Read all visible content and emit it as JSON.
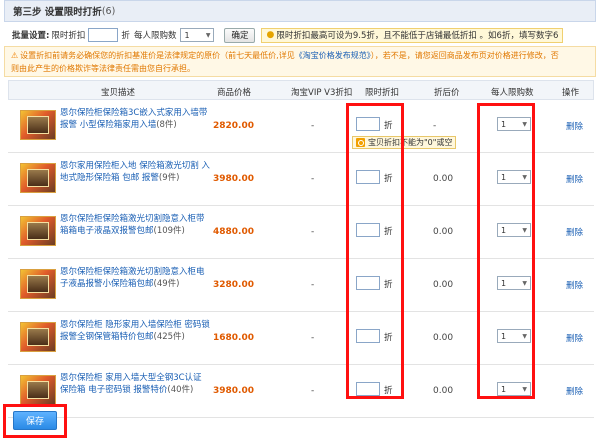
{
  "header": {
    "title": "第三步 设置限时打折",
    "count": "(6)"
  },
  "batch": {
    "label": "批量设置:",
    "discount_label": "限时折扣",
    "unit": "折",
    "limit_label": "每人限购数",
    "limit_value": "1",
    "confirm_label": "确定",
    "tip": "限时折扣最高可设为9.5折，且不能低于店铺最低折扣 。如6折，填写数字6"
  },
  "notice": {
    "line1_pre": "设置折扣前请务必确保您的折扣基准价是法律规定的原价（前七天最低价,详见",
    "link": "《淘宝价格发布规范》",
    "line1_post": "），若不是，请您返回商品发布页对价格进行修改，否",
    "line2": "则由此产生的价格欺诈等法律责任需由您自行承担。"
  },
  "table": {
    "columns": {
      "item": "宝贝描述",
      "price": "商品价格",
      "vip": "淘宝VIP V3折扣",
      "discount": "限时折扣",
      "after": "折后价",
      "limit": "每人限购数",
      "op": "操作"
    },
    "rows": [
      {
        "name": "恩尔保险柜保险箱3C嵌入式家用入墙带报警 小型保险箱家用入墙",
        "count": "(8件)",
        "price": "2820.00",
        "vip": "-",
        "unit": "折",
        "after": "-",
        "limit": "1",
        "op": "删除"
      },
      {
        "name": "恩尔家用保险柜入地 保险箱激光切割 入地式隐形保险箱 包邮 报警",
        "count": "(9件)",
        "price": "3980.00",
        "vip": "-",
        "unit": "折",
        "after": "0.00",
        "limit": "1",
        "op": "删除"
      },
      {
        "name": "恩尔保险柜保险箱激光切割隐意入柜带箱箱电子液晶双报警包邮",
        "count": "(109件)",
        "price": "4880.00",
        "vip": "-",
        "unit": "折",
        "after": "0.00",
        "limit": "1",
        "op": "删除"
      },
      {
        "name": "恩尔保险柜保险箱激光切割隐意入柜电子液晶报警小保险箱包邮",
        "count": "(49件)",
        "price": "3280.00",
        "vip": "-",
        "unit": "折",
        "after": "0.00",
        "limit": "1",
        "op": "删除"
      },
      {
        "name": "恩尔保险柜 隐形家用入墙保险柜 密码锁报警全钢保管箱特价包邮",
        "count": "(425件)",
        "price": "1680.00",
        "vip": "-",
        "unit": "折",
        "after": "0.00",
        "limit": "1",
        "op": "删除"
      },
      {
        "name": "恩尔保险柜 家用入墙大型全钢3C认证保险箱 电子密码锁 报警特价",
        "count": "(40件)",
        "price": "3980.00",
        "vip": "-",
        "unit": "折",
        "after": "0.00",
        "limit": "1",
        "op": "删除"
      }
    ]
  },
  "error_tip": "宝贝折扣不能为\"0\"或空",
  "save_label": "保存",
  "colors": {
    "highlight": "#ff1010",
    "price": "#e05a00",
    "link": "#1a5fb4",
    "save": "#2a8ae6"
  }
}
